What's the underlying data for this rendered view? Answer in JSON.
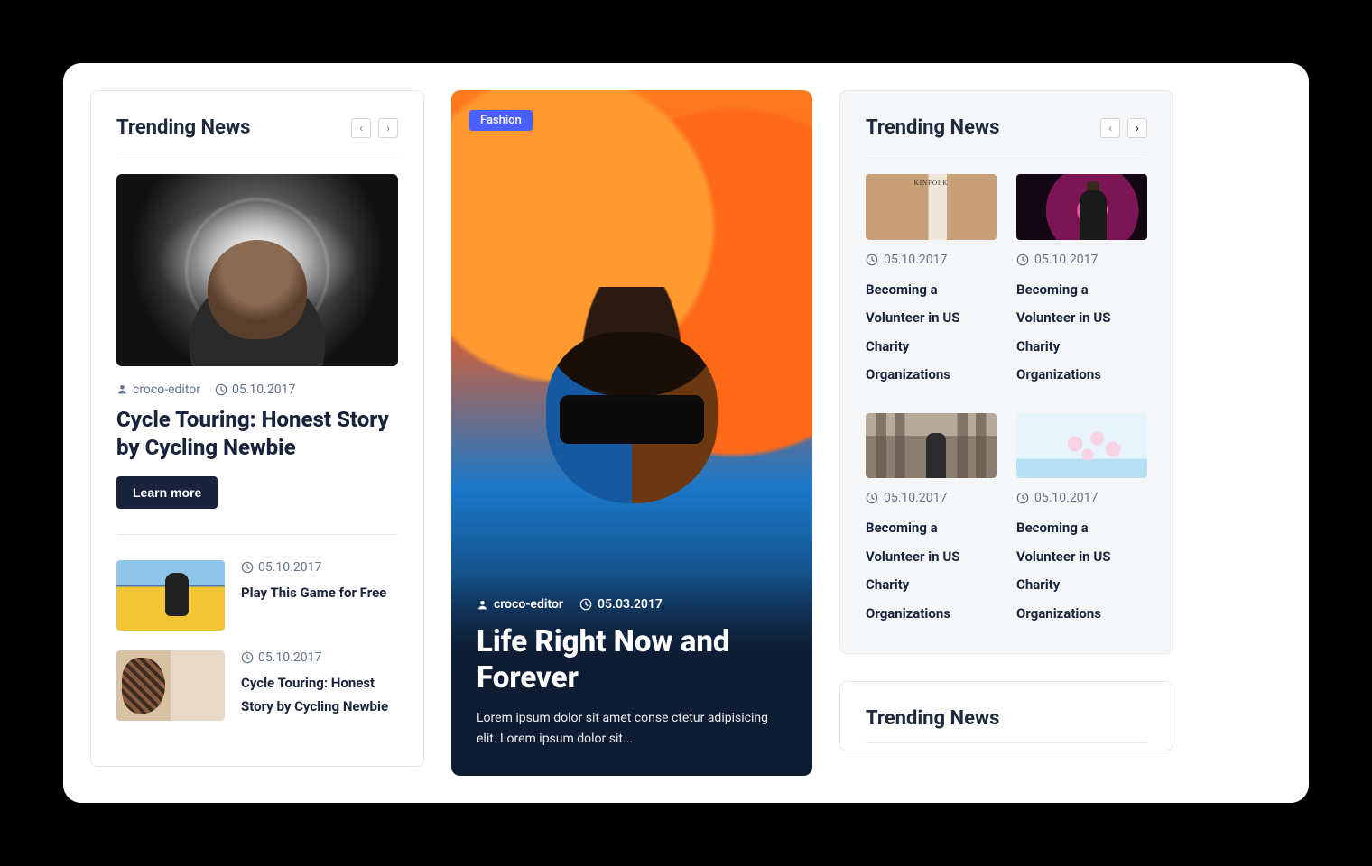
{
  "left_panel": {
    "title": "Trending News",
    "feature": {
      "author": "croco-editor",
      "date": "05.10.2017",
      "title": "Cycle Touring: Honest Story by Cycling Newbie",
      "button": "Learn more"
    },
    "items": [
      {
        "date": "05.10.2017",
        "title": "Play This Game for Free"
      },
      {
        "date": "05.10.2017",
        "title": "Cycle Touring: Honest Story by Cycling Newbie"
      }
    ]
  },
  "hero": {
    "badge": "Fashion",
    "author": "croco-editor",
    "date": "05.03.2017",
    "title": "Life Right Now and Forever",
    "excerpt": "Lorem ipsum dolor sit amet conse ctetur adipisicing elit. Lorem ipsum dolor sit..."
  },
  "right_panel": {
    "title": "Trending News",
    "items": [
      {
        "date": "05.10.2017",
        "title": "Becoming a Volunteer in US Charity Organizations"
      },
      {
        "date": "05.10.2017",
        "title": "Becoming a Volunteer in US Charity Organizations"
      },
      {
        "date": "05.10.2017",
        "title": "Becoming a Volunteer in US Charity Organizations"
      },
      {
        "date": "05.10.2017",
        "title": "Becoming a Volunteer in US Charity Organizations"
      }
    ]
  },
  "right_panel_2": {
    "title": "Trending News"
  }
}
